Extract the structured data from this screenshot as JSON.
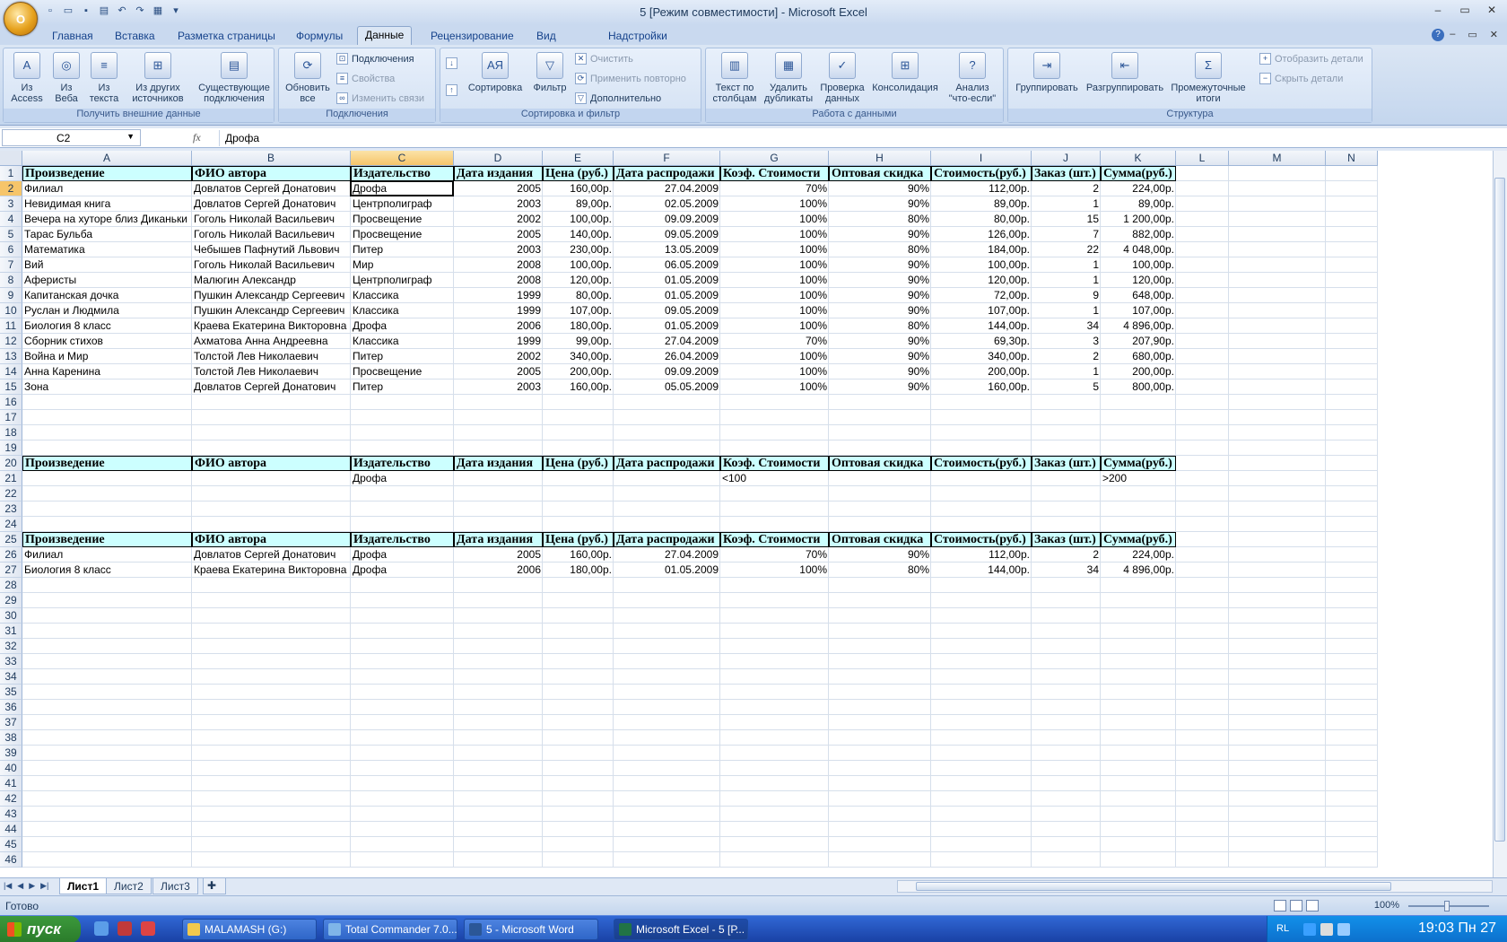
{
  "window": {
    "title": "5  [Режим совместимости] - Microsoft Excel",
    "office_button_label": "O"
  },
  "ribbon_tabs": [
    "Главная",
    "Вставка",
    "Разметка страницы",
    "Формулы",
    "Данные",
    "Рецензирование",
    "Вид",
    "Надстройки"
  ],
  "active_tab": "Данные",
  "ribbon": {
    "get_external": {
      "label": "Получить внешние данные",
      "access": "Из Access",
      "web": "Из Веба",
      "text": "Из текста",
      "other": "Из других источников",
      "existing": "Существующие подключения"
    },
    "connections": {
      "label": "Подключения",
      "refresh": "Обновить все",
      "connections": "Подключения",
      "properties": "Свойства",
      "edit_links": "Изменить связи"
    },
    "sort_filter": {
      "label": "Сортировка и фильтр",
      "sort": "Сортировка",
      "filter": "Фильтр",
      "clear": "Очистить",
      "reapply": "Применить повторно",
      "advanced": "Дополнительно"
    },
    "data_tools": {
      "label": "Работа с данными",
      "text_to_cols": "Текст по столбцам",
      "remove_dup": "Удалить дубликаты",
      "validation": "Проверка данных",
      "consolidate": "Консолидация",
      "whatif": "Анализ \"что-если\""
    },
    "outline": {
      "label": "Структура",
      "group": "Группировать",
      "ungroup": "Разгруппировать",
      "subtotal": "Промежуточные итоги",
      "show_detail": "Отобразить детали",
      "hide_detail": "Скрыть детали"
    }
  },
  "formula_bar": {
    "name_box": "C2",
    "fx": "fx",
    "content": "Дрофа"
  },
  "columns": [
    "A",
    "B",
    "C",
    "D",
    "E",
    "F",
    "G",
    "H",
    "I",
    "J",
    "K",
    "L",
    "M",
    "N"
  ],
  "headers": [
    "Произведение",
    "ФИО автора",
    "Издательство",
    "Дата издания",
    "Цена (руб.)",
    "Дата распродажи",
    "Коэф. Стоимости",
    "Оптовая скидка",
    "Стоимость(руб.)",
    "Заказ (шт.)",
    "Сумма(руб.)"
  ],
  "rows": [
    [
      "Филиал",
      "Довлатов Сергей Донатович",
      "Дрофа",
      "2005",
      "160,00р.",
      "27.04.2009",
      "70%",
      "90%",
      "112,00р.",
      "2",
      "224,00р."
    ],
    [
      "Невидимая книга",
      "Довлатов Сергей Донатович",
      "Центрполиграф",
      "2003",
      "89,00р.",
      "02.05.2009",
      "100%",
      "90%",
      "89,00р.",
      "1",
      "89,00р."
    ],
    [
      "Вечера на хуторе близ Диканьки",
      "Гоголь Николай Васильевич",
      "Просвещение",
      "2002",
      "100,00р.",
      "09.09.2009",
      "100%",
      "80%",
      "80,00р.",
      "15",
      "1 200,00р."
    ],
    [
      "Тарас Бульба",
      "Гоголь Николай Васильевич",
      "Просвещение",
      "2005",
      "140,00р.",
      "09.05.2009",
      "100%",
      "90%",
      "126,00р.",
      "7",
      "882,00р."
    ],
    [
      "Математика",
      "Чебышев Пафнутий Львович",
      "Питер",
      "2003",
      "230,00р.",
      "13.05.2009",
      "100%",
      "80%",
      "184,00р.",
      "22",
      "4 048,00р."
    ],
    [
      "Вий",
      "Гоголь Николай Васильевич",
      "Мир",
      "2008",
      "100,00р.",
      "06.05.2009",
      "100%",
      "90%",
      "100,00р.",
      "1",
      "100,00р."
    ],
    [
      "Аферисты",
      "Малюгин Александр",
      "Центрполиграф",
      "2008",
      "120,00р.",
      "01.05.2009",
      "100%",
      "90%",
      "120,00р.",
      "1",
      "120,00р."
    ],
    [
      "Капитанская дочка",
      "Пушкин Александр Сергеевич",
      "Классика",
      "1999",
      "80,00р.",
      "01.05.2009",
      "100%",
      "90%",
      "72,00р.",
      "9",
      "648,00р."
    ],
    [
      "Руслан и Людмила",
      "Пушкин Александр Сергеевич",
      "Классика",
      "1999",
      "107,00р.",
      "09.05.2009",
      "100%",
      "90%",
      "107,00р.",
      "1",
      "107,00р."
    ],
    [
      "Биология 8 класс",
      "Краева Екатерина Викторовна",
      "Дрофа",
      "2006",
      "180,00р.",
      "01.05.2009",
      "100%",
      "80%",
      "144,00р.",
      "34",
      "4 896,00р."
    ],
    [
      "Сборник стихов",
      "Ахматова Анна Андреевна",
      "Классика",
      "1999",
      "99,00р.",
      "27.04.2009",
      "70%",
      "90%",
      "69,30р.",
      "3",
      "207,90р."
    ],
    [
      "Война и Мир",
      "Толстой Лев Николаевич",
      "Питер",
      "2002",
      "340,00р.",
      "26.04.2009",
      "100%",
      "90%",
      "340,00р.",
      "2",
      "680,00р."
    ],
    [
      "Анна Каренина",
      "Толстой Лев Николаевич",
      "Просвещение",
      "2005",
      "200,00р.",
      "09.09.2009",
      "100%",
      "90%",
      "200,00р.",
      "1",
      "200,00р."
    ],
    [
      "Зона",
      "Довлатов Сергей Донатович",
      "Питер",
      "2003",
      "160,00р.",
      "05.05.2009",
      "100%",
      "90%",
      "160,00р.",
      "5",
      "800,00р."
    ]
  ],
  "criteria": {
    "publisher": "Дрофа",
    "coef": "<100",
    "sum": ">200"
  },
  "results": [
    [
      "Филиал",
      "Довлатов Сергей Донатович",
      "Дрофа",
      "2005",
      "160,00р.",
      "27.04.2009",
      "70%",
      "90%",
      "112,00р.",
      "2",
      "224,00р."
    ],
    [
      "Биология 8 класс",
      "Краева Екатерина Викторовна",
      "Дрофа",
      "2006",
      "180,00р.",
      "01.05.2009",
      "100%",
      "80%",
      "144,00р.",
      "34",
      "4 896,00р."
    ]
  ],
  "sheets": [
    "Лист1",
    "Лист2",
    "Лист3"
  ],
  "status": {
    "text": "Готово",
    "zoom": "100%"
  },
  "taskbar": {
    "start": "пуск",
    "buttons": [
      "MALAMASH (G:)",
      "Total Commander 7.0...",
      "5 - Microsoft Word",
      "Microsoft Excel - 5 [Р..."
    ],
    "lang": "RL",
    "clock": "19:03 Пн 27"
  }
}
